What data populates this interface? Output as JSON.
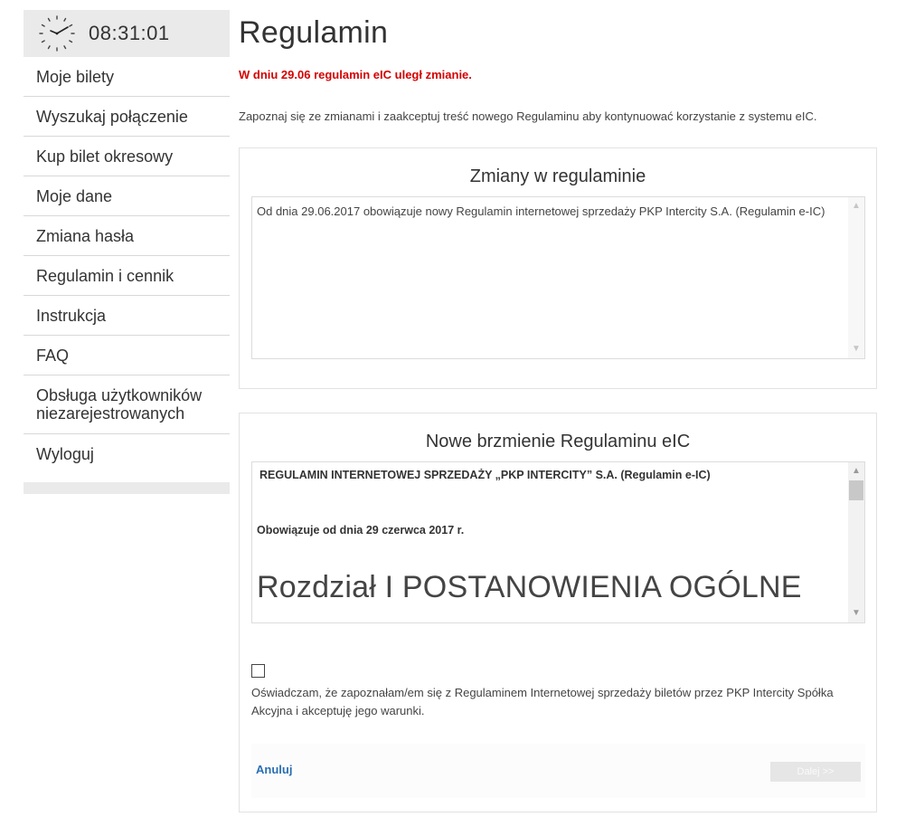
{
  "clock": {
    "time": "08:31:01"
  },
  "menu": [
    {
      "label": "Moje bilety"
    },
    {
      "label": "Wyszukaj połączenie"
    },
    {
      "label": "Kup bilet okresowy"
    },
    {
      "label": "Moje dane"
    },
    {
      "label": "Zmiana hasła"
    },
    {
      "label": "Regulamin i cennik"
    },
    {
      "label": "Instrukcja"
    },
    {
      "label": "FAQ"
    },
    {
      "label": "Obsługa użytkowników niezarejestrowanych"
    },
    {
      "label": "Wyloguj"
    }
  ],
  "page": {
    "title": "Regulamin",
    "alert": "W dniu 29.06 regulamin eIC uległ zmianie.",
    "intro": "Zapoznaj się ze zmianami i zaakceptuj treść nowego Regulaminu aby kontynuować korzystanie z systemu eIC."
  },
  "changes": {
    "title": "Zmiany w regulaminie",
    "text": "Od dnia 29.06.2017 obowiązuje nowy Regulamin internetowej sprzedaży PKP Intercity S.A. (Regulamin e-IC)"
  },
  "new_terms": {
    "title": "Nowe brzmienie Regulaminu eIC",
    "heading": "REGULAMIN INTERNETOWEJ SPRZEDAŻY „PKP INTERCITY” S.A. (Regulamin e-IC)",
    "effective": "Obowiązuje od dnia 29 czerwca 2017 r.",
    "chapter": "Rozdział I POSTANOWIENIA OGÓLNE"
  },
  "consent": {
    "text": "Oświadczam, że zapoznałam/em się z Regulaminem Internetowej sprzedaży biletów przez PKP Intercity Spółka Akcyjna i akceptuję jego warunki.",
    "checked": false
  },
  "actions": {
    "cancel_label": "Anuluj",
    "next_label": "Dalej >>"
  },
  "colors": {
    "alert": "#d40000",
    "link": "#2a6fb3",
    "sidebar_bg": "#eaeaea"
  },
  "icons": {
    "clock": "clock-icon",
    "scroll_up": "chevron-up-icon",
    "scroll_down": "chevron-down-icon"
  }
}
